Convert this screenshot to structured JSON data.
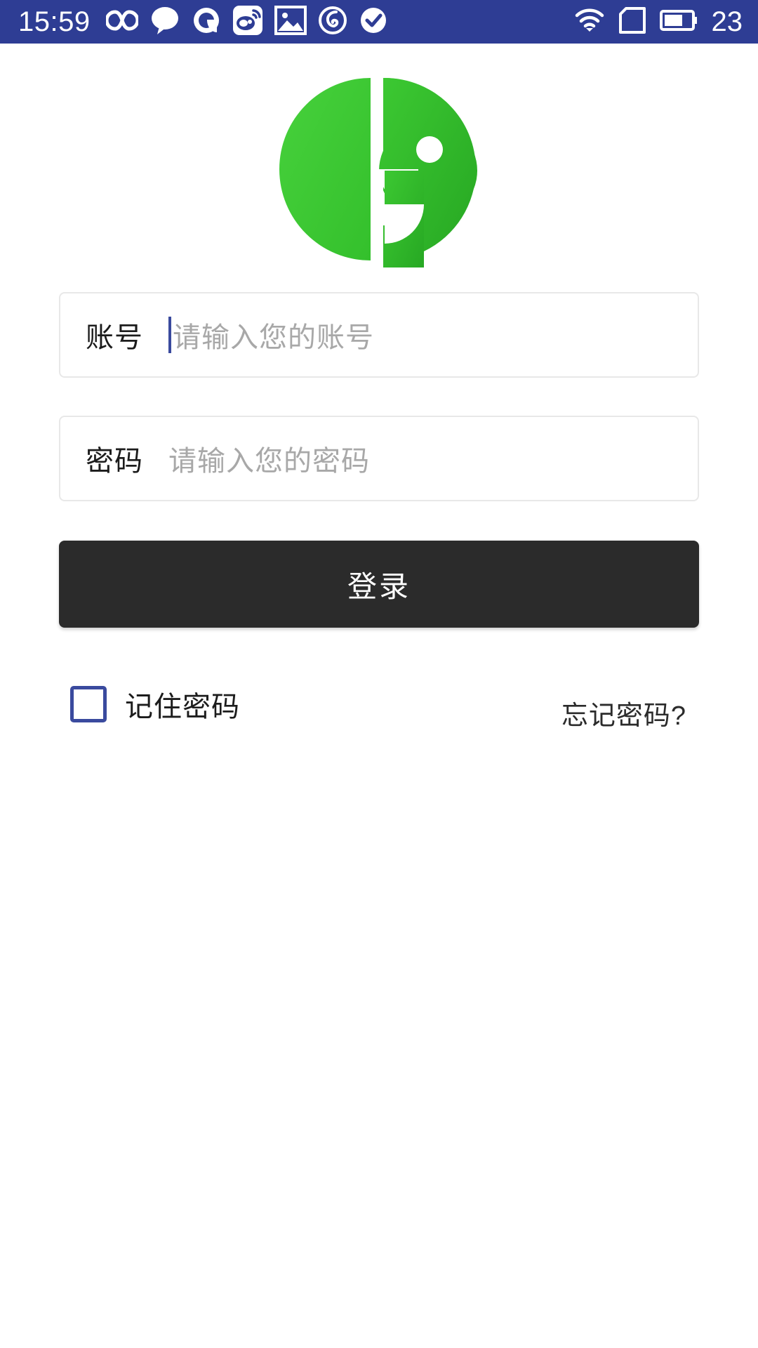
{
  "status_bar": {
    "background_color": "#2e3d94",
    "clock": "15:59",
    "battery_level": "23",
    "left_icons": [
      "infinity-icon",
      "speech-bubble-icon",
      "qq-icon",
      "weibo-icon",
      "photo-gallery-icon",
      "netease-music-icon",
      "checkmark-circle-icon"
    ],
    "right_icons": [
      "wifi-icon",
      "sim-card-icon",
      "battery-icon"
    ]
  },
  "logo": {
    "name": "app-logo",
    "color_light": "#3cc832",
    "color_dark": "#2fb62a"
  },
  "form": {
    "account": {
      "label": "账号",
      "placeholder": "请输入您的账号",
      "value": "",
      "focused": true
    },
    "password": {
      "label": "密码",
      "placeholder": "请输入您的密码",
      "value": "",
      "focused": false
    },
    "login_button_label": "登录",
    "remember_password_label": "记住密码",
    "remember_password_checked": false,
    "forgot_password_label": "忘记密码?"
  },
  "colors": {
    "accent_blue": "#3a4a9e",
    "button_dark": "#2b2b2b",
    "placeholder_gray": "#a8a8a8",
    "border_gray": "#e8e8e8"
  }
}
